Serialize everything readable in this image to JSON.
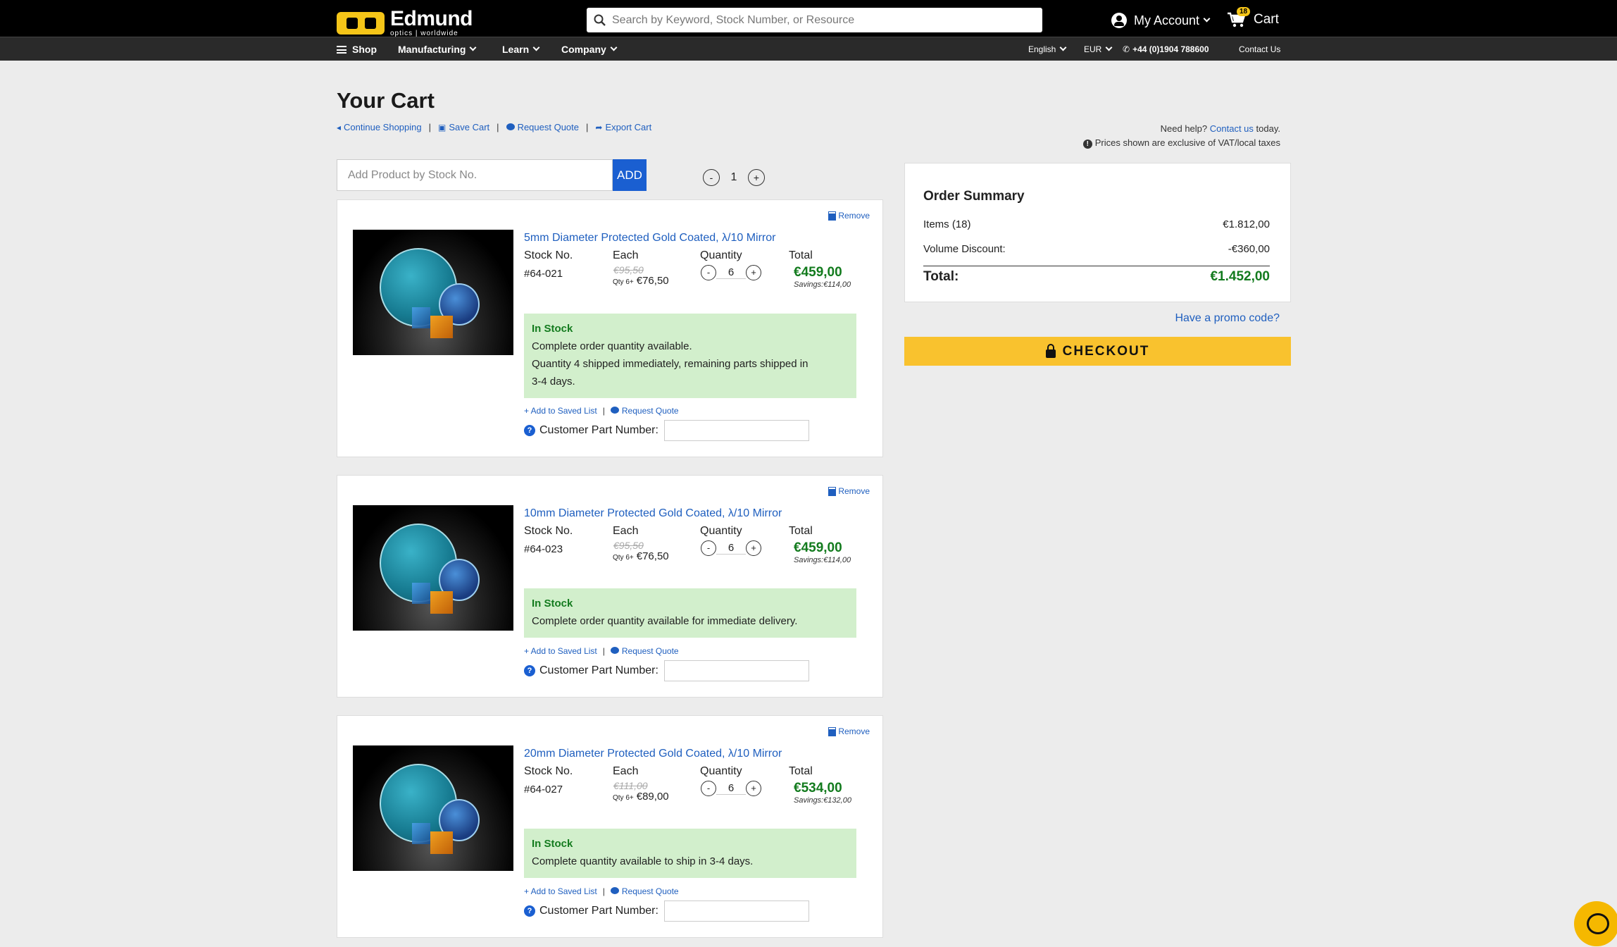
{
  "brand": {
    "name": "Edmund",
    "sub": "optics | worldwide"
  },
  "search": {
    "placeholder": "Search by Keyword, Stock Number, or Resource"
  },
  "account": {
    "label": "My Account"
  },
  "cart": {
    "label": "Cart",
    "count": "18"
  },
  "nav": {
    "shop": "Shop",
    "manufacturing": "Manufacturing",
    "learn": "Learn",
    "company": "Company",
    "language": "English",
    "currency": "EUR",
    "phone": "+44 (0)1904 788600",
    "contact": "Contact Us"
  },
  "page": {
    "title": "Your Cart",
    "continue_shopping": "Continue Shopping",
    "save_cart": "Save Cart",
    "request_quote": "Request Quote",
    "export_cart": "Export Cart",
    "help_prefix": "Need help?",
    "help_link": "Contact us",
    "help_suffix": "today.",
    "vat_note": "Prices shown are exclusive of VAT/local taxes"
  },
  "add_product": {
    "placeholder": "Add Product by Stock No.",
    "button": "ADD",
    "qty": "1"
  },
  "labels": {
    "stock_no": "Stock No.",
    "each": "Each",
    "quantity": "Quantity",
    "total": "Total",
    "remove": "Remove",
    "add_saved": "+ Add to Saved List",
    "request_quote": "Request Quote",
    "customer_part": "Customer Part Number:",
    "qty_break": "Qty 6+"
  },
  "items": [
    {
      "title": "5mm Diameter Protected Gold Coated, λ/10 Mirror",
      "stock_no": "#64-021",
      "price_old": "€95,50",
      "price_new": "€76,50",
      "qty": "6",
      "total": "€459,00",
      "savings": "Savings:€114,00",
      "stock_title": "In Stock",
      "stock_msg": [
        "Complete order quantity available.",
        "Quantity 4 shipped immediately, remaining parts shipped in",
        "3-4 days."
      ]
    },
    {
      "title": "10mm Diameter Protected Gold Coated, λ/10 Mirror",
      "stock_no": "#64-023",
      "price_old": "€95,50",
      "price_new": "€76,50",
      "qty": "6",
      "total": "€459,00",
      "savings": "Savings:€114,00",
      "stock_title": "In Stock",
      "stock_msg": [
        "Complete order quantity available for immediate delivery."
      ]
    },
    {
      "title": "20mm Diameter Protected Gold Coated, λ/10 Mirror",
      "stock_no": "#64-027",
      "price_old": "€111,00",
      "price_new": "€89,00",
      "qty": "6",
      "total": "€534,00",
      "savings": "Savings:€132,00",
      "stock_title": "In Stock",
      "stock_msg": [
        "Complete quantity available to ship in 3-4 days."
      ]
    }
  ],
  "summary": {
    "title": "Order Summary",
    "items_label": "Items (18)",
    "items_value": "€1.812,00",
    "discount_label": "Volume Discount:",
    "discount_value": "-€360,00",
    "total_label": "Total:",
    "total_value": "€1.452,00",
    "promo": "Have a promo code?",
    "checkout": "CHECKOUT"
  },
  "colors": {
    "accent": "#f9c22e",
    "link": "#1f5fbf",
    "price_green": "#137b1e",
    "stock_bg": "#d2efcc"
  }
}
